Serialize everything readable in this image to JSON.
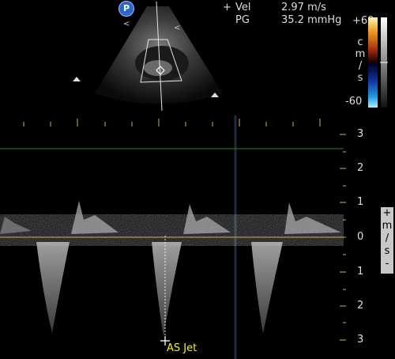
{
  "probe_badge": "P",
  "measurement": {
    "cursor_symbol": "+",
    "vel_label": "Vel",
    "vel_value": "2.97 m/s",
    "pg_label": "PG",
    "pg_value": "35.2 mmHg"
  },
  "color_bar": {
    "top_label": "+60",
    "bottom_label": "-60",
    "unit_letters": [
      "c",
      "m",
      "/",
      "s"
    ]
  },
  "doppler_scale": {
    "labels": [
      "3",
      "2",
      "1",
      "0",
      "1",
      "2",
      "3"
    ],
    "unit_letters": [
      "+",
      "m",
      "/",
      "s",
      "-"
    ]
  },
  "annotation": "AS Jet",
  "colors": {
    "annotation": "#f2ee29",
    "probe_badge": "#2c66c7",
    "baseline": "#c8b35a",
    "threshold_line": "#3a7a3a"
  }
}
